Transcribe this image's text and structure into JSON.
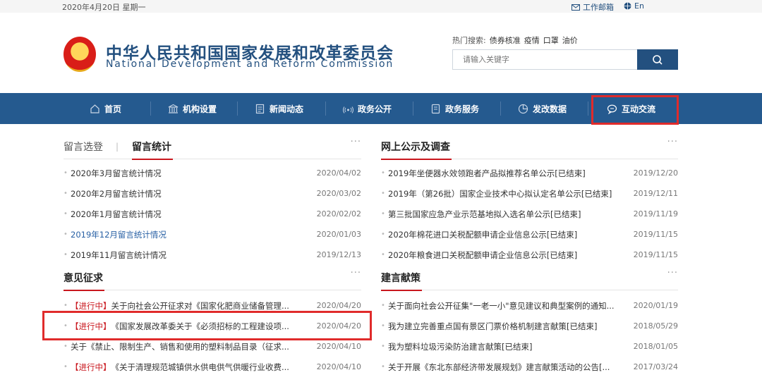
{
  "topbar": {
    "date": "2020年4月20日 星期一",
    "mail_label": "工作邮箱",
    "lang_label": "En"
  },
  "header": {
    "title_cn": "中华人民共和国国家发展和改革委员会",
    "title_en": "National Development and Reform Commission"
  },
  "search": {
    "hot_label": "热门搜索:",
    "hot_keywords": [
      "债券核准",
      "疫情",
      "口罩",
      "油价"
    ],
    "placeholder": "请输入关键字"
  },
  "nav": {
    "items": [
      {
        "label": "首页",
        "icon": "home-icon"
      },
      {
        "label": "机构设置",
        "icon": "institution-icon"
      },
      {
        "label": "新闻动态",
        "icon": "news-icon"
      },
      {
        "label": "政务公开",
        "icon": "broadcast-icon"
      },
      {
        "label": "政务服务",
        "icon": "service-icon"
      },
      {
        "label": "发改数据",
        "icon": "chart-icon"
      },
      {
        "label": "互动交流",
        "icon": "chat-icon"
      }
    ],
    "active_color": "#e02b2b"
  },
  "panel_messages": {
    "tab_inactive": "留言选登",
    "tab_active": "留言统计",
    "more": "···",
    "rows": [
      {
        "text": "2020年3月留言统计情况",
        "date": "2020/04/02"
      },
      {
        "text": "2020年2月留言统计情况",
        "date": "2020/03/02"
      },
      {
        "text": "2020年1月留言统计情况",
        "date": "2020/02/02"
      },
      {
        "text": "2019年12月留言统计情况",
        "date": "2020/01/03"
      },
      {
        "text": "2019年11月留言统计情况",
        "date": "2019/12/13"
      }
    ]
  },
  "panel_public": {
    "title": "网上公示及调查",
    "more": "···",
    "rows": [
      {
        "text": "2019年坐便器水效领跑者产品拟推荐名单公示[已结束]",
        "date": "2019/12/20"
      },
      {
        "text": "2019年（第26批）国家企业技术中心拟认定名单公示[已结束]",
        "date": "2019/12/11"
      },
      {
        "text": "第三批国家应急产业示范基地拟入选名单公示[已结束]",
        "date": "2019/11/19"
      },
      {
        "text": "2020年棉花进口关税配额申请企业信息公示[已结束]",
        "date": "2019/11/15"
      },
      {
        "text": "2020年粮食进口关税配额申请企业信息公示[已结束]",
        "date": "2019/11/15"
      }
    ]
  },
  "panel_opinion": {
    "title": "意见征求",
    "more": "···",
    "rows": [
      {
        "tag": "【进行中】",
        "text": "关于向社会公开征求对《国家化肥商业储备管理...",
        "date": "2020/04/20"
      },
      {
        "tag": "【进行中】",
        "text": "《国家发展改革委关于《必须招标的工程建设项...",
        "date": "2020/04/20"
      },
      {
        "tag": "",
        "text": "关于《禁止、限制生产、销售和使用的塑料制品目录（征求...",
        "date": "2020/04/10"
      },
      {
        "tag": "【进行中】",
        "text": "《关于清理规范城镇供水供电供气供暖行业收费...",
        "date": "2020/04/10"
      }
    ]
  },
  "panel_advice": {
    "title": "建言献策",
    "more": "···",
    "rows": [
      {
        "text": "关于面向社会公开征集\"一老一小\"意见建议和典型案例的通知...",
        "date": "2020/01/19"
      },
      {
        "text": "我为建立完善重点国有景区门票价格机制建言献策[已结束]",
        "date": "2018/05/29"
      },
      {
        "text": "我为塑料垃圾污染防治建言献策[已结束]",
        "date": "2018/01/05"
      },
      {
        "text": "关于开展《东北东部经济带发展规划》建言献策活动的公告[...",
        "date": "2017/03/24"
      }
    ]
  }
}
